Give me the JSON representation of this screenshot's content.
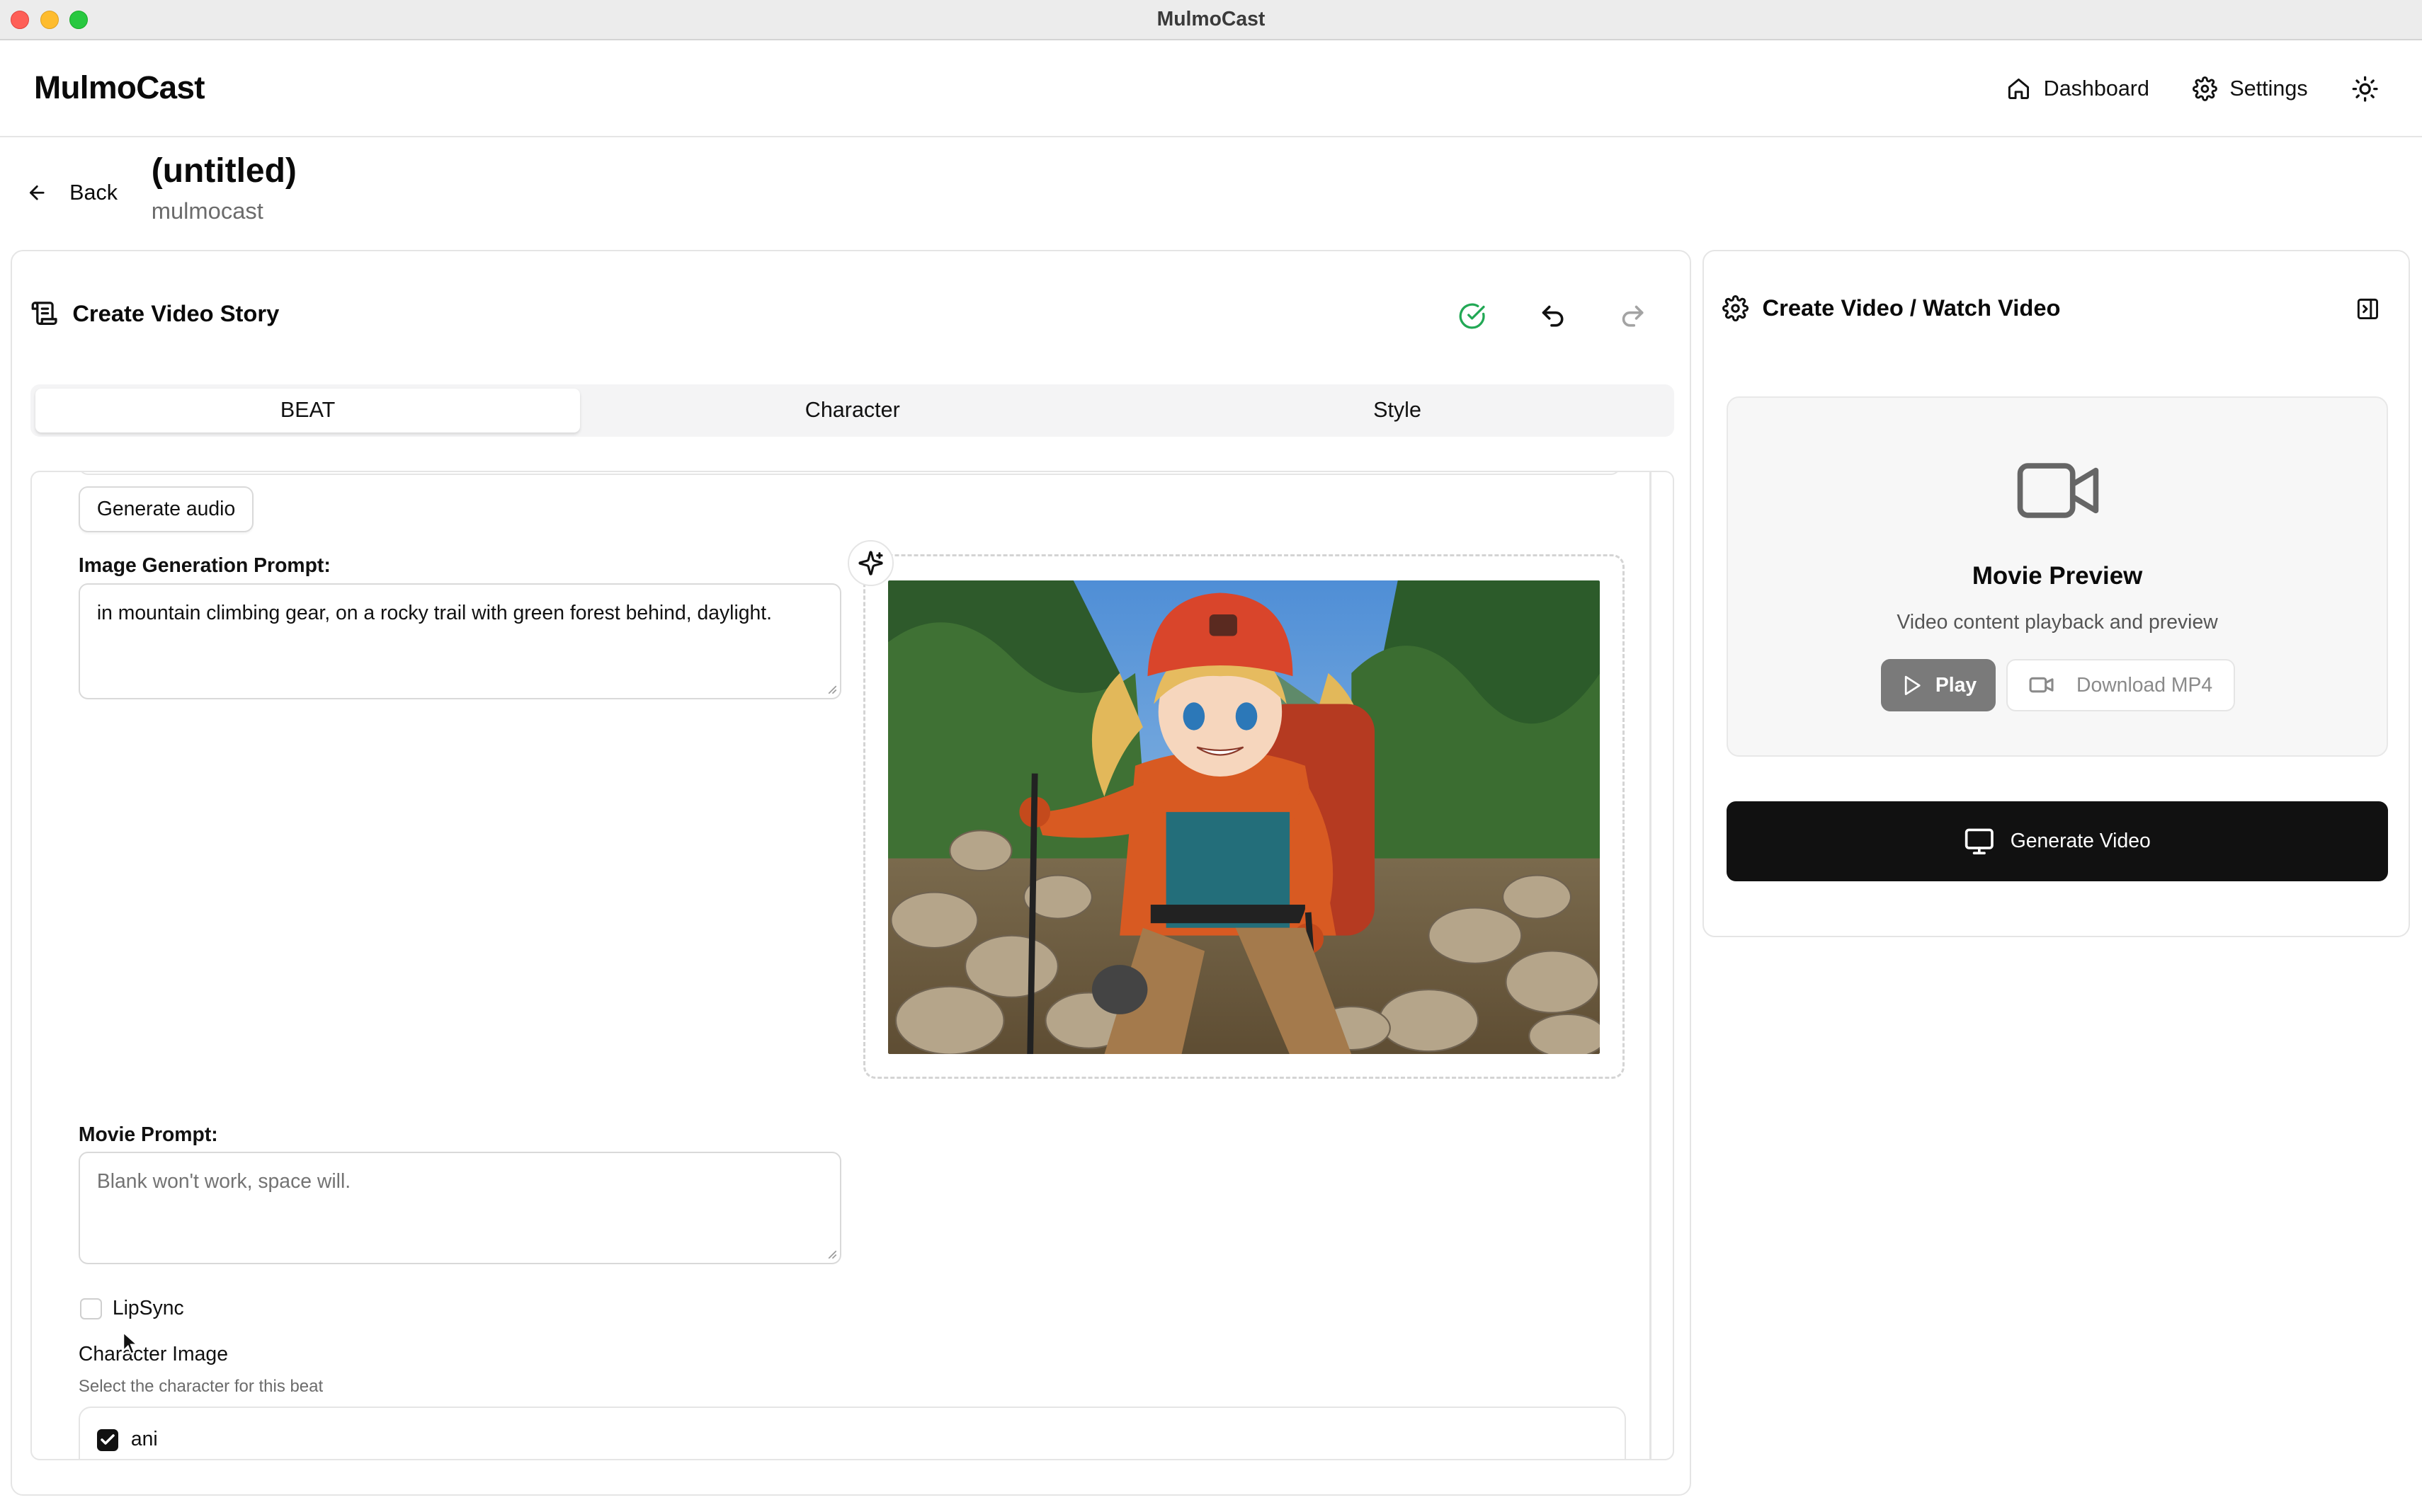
{
  "window": {
    "title": "MulmoCast"
  },
  "header": {
    "brand": "MulmoCast",
    "nav": [
      {
        "label": "Dashboard",
        "icon": "home-icon"
      },
      {
        "label": "Settings",
        "icon": "gear-icon"
      }
    ],
    "theme_icon": "sun-icon"
  },
  "page": {
    "back_label": "Back",
    "title": "(untitled)",
    "subtitle": "mulmocast"
  },
  "editor": {
    "title": "Create Video Story",
    "tabs": [
      {
        "label": "BEAT",
        "active": true
      },
      {
        "label": "Character",
        "active": false
      },
      {
        "label": "Style",
        "active": false
      }
    ],
    "generate_audio_label": "Generate audio",
    "image_prompt": {
      "label": "Image Generation Prompt:",
      "value": "in mountain climbing gear, on a rocky trail with green forest behind, daylight."
    },
    "movie_prompt": {
      "label": "Movie Prompt:",
      "placeholder": "Blank won't work, space will."
    },
    "lipsync": {
      "label": "LipSync",
      "checked": false
    },
    "character_image": {
      "label": "Character Image",
      "help": "Select the character for this beat",
      "options": [
        {
          "label": "ani",
          "checked": true
        }
      ]
    }
  },
  "preview": {
    "title": "Create Video / Watch Video",
    "movie_title": "Movie Preview",
    "movie_subtitle": "Video content playback and preview",
    "play_label": "Play",
    "download_label": "Download MP4",
    "generate_label": "Generate Video"
  },
  "colors": {
    "accent": "#111111",
    "success": "#22a855",
    "muted": "#6b6b6b"
  }
}
